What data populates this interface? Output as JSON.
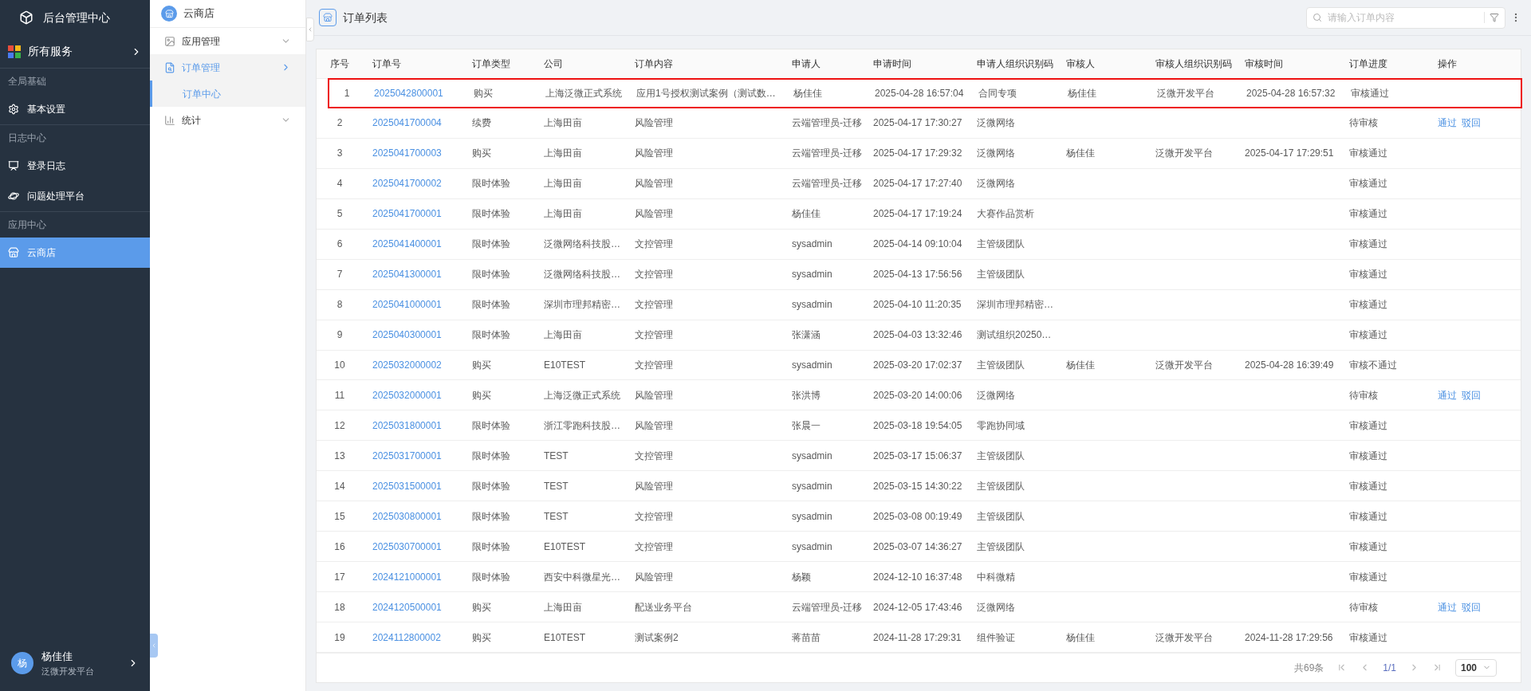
{
  "sidebar": {
    "title": "后台管理中心",
    "services": "所有服务",
    "sections": [
      {
        "label": "全局基础",
        "items": [
          {
            "label": "基本设置",
            "selected": false
          }
        ]
      },
      {
        "label": "日志中心",
        "items": [
          {
            "label": "登录日志",
            "selected": false
          },
          {
            "label": "问题处理平台",
            "selected": false
          }
        ]
      },
      {
        "label": "应用中心",
        "items": [
          {
            "label": "云商店",
            "selected": true
          }
        ]
      }
    ],
    "user": {
      "avatar": "杨",
      "name": "杨佳佳",
      "org": "泛微开发平台"
    }
  },
  "subnav": {
    "title": "云商店",
    "items": [
      {
        "label": "应用管理",
        "selected": false,
        "expanded": false
      },
      {
        "label": "订单管理",
        "selected": true,
        "expanded": true,
        "children": [
          {
            "label": "订单中心",
            "selected": true
          }
        ]
      },
      {
        "label": "统计",
        "selected": false,
        "expanded": false
      }
    ]
  },
  "header": {
    "title": "订单列表",
    "search": {
      "placeholder": "请输入订单内容"
    }
  },
  "table": {
    "columns": [
      "序号",
      "订单号",
      "订单类型",
      "公司",
      "订单内容",
      "申请人",
      "申请时间",
      "申请人组织识别码",
      "审核人",
      "审核人组织识别码",
      "审核时间",
      "订单进度",
      "操作"
    ],
    "rows": [
      {
        "seq": "1",
        "order_no": "2025042800001",
        "type": "购买",
        "company": "上海泛微正式系统",
        "content": "应用1号授权测试案例（测试数…",
        "applicant": "杨佳佳",
        "apply_time": "2025-04-28 16:57:04",
        "applicant_org": "合同专项",
        "reviewer": "杨佳佳",
        "reviewer_org": "泛微开发平台",
        "review_time": "2025-04-28 16:57:32",
        "progress": "审核通过",
        "highlighted": true
      },
      {
        "seq": "2",
        "order_no": "2025041700004",
        "type": "续费",
        "company": "上海田亩",
        "content": "风险管理",
        "applicant": "云端管理员-迁移",
        "apply_time": "2025-04-17 17:30:27",
        "applicant_org": "泛微网络",
        "progress": "待审核",
        "actions": [
          "通过",
          "驳回"
        ],
        "highlighted": false
      },
      {
        "seq": "3",
        "order_no": "2025041700003",
        "type": "购买",
        "company": "上海田亩",
        "content": "风险管理",
        "applicant": "云端管理员-迁移",
        "apply_time": "2025-04-17 17:29:32",
        "applicant_org": "泛微网络",
        "reviewer": "杨佳佳",
        "reviewer_org": "泛微开发平台",
        "review_time": "2025-04-17 17:29:51",
        "progress": "审核通过",
        "highlighted": false
      },
      {
        "seq": "4",
        "order_no": "2025041700002",
        "type": "限时体验",
        "company": "上海田亩",
        "content": "风险管理",
        "applicant": "云端管理员-迁移",
        "apply_time": "2025-04-17 17:27:40",
        "applicant_org": "泛微网络",
        "progress": "审核通过",
        "highlighted": false
      },
      {
        "seq": "5",
        "order_no": "2025041700001",
        "type": "限时体验",
        "company": "上海田亩",
        "content": "风险管理",
        "applicant": "杨佳佳",
        "apply_time": "2025-04-17 17:19:24",
        "applicant_org": "大赛作品赏析",
        "progress": "审核通过",
        "highlighted": false
      },
      {
        "seq": "6",
        "order_no": "2025041400001",
        "type": "限时体验",
        "company": "泛微网络科技股…",
        "content": "文控管理",
        "applicant": "sysadmin",
        "apply_time": "2025-04-14 09:10:04",
        "applicant_org": "主管级团队",
        "progress": "审核通过",
        "highlighted": false
      },
      {
        "seq": "7",
        "order_no": "2025041300001",
        "type": "限时体验",
        "company": "泛微网络科技股…",
        "content": "文控管理",
        "applicant": "sysadmin",
        "apply_time": "2025-04-13 17:56:56",
        "applicant_org": "主管级团队",
        "progress": "审核通过",
        "highlighted": false
      },
      {
        "seq": "8",
        "order_no": "2025041000001",
        "type": "限时体验",
        "company": "深圳市理邦精密…",
        "content": "文控管理",
        "applicant": "sysadmin",
        "apply_time": "2025-04-10 11:20:35",
        "applicant_org": "深圳市理邦精密…",
        "progress": "审核通过",
        "highlighted": false
      },
      {
        "seq": "9",
        "order_no": "2025040300001",
        "type": "限时体验",
        "company": "上海田亩",
        "content": "文控管理",
        "applicant": "张潇涵",
        "apply_time": "2025-04-03 13:32:46",
        "applicant_org": "测试组织20250…",
        "progress": "审核通过",
        "highlighted": false
      },
      {
        "seq": "10",
        "order_no": "2025032000002",
        "type": "购买",
        "company": "E10TEST",
        "content": "文控管理",
        "applicant": "sysadmin",
        "apply_time": "2025-03-20 17:02:37",
        "applicant_org": "主管级团队",
        "reviewer": "杨佳佳",
        "reviewer_org": "泛微开发平台",
        "review_time": "2025-04-28 16:39:49",
        "progress": "审核不通过",
        "highlighted": false
      },
      {
        "seq": "11",
        "order_no": "2025032000001",
        "type": "购买",
        "company": "上海泛微正式系统",
        "content": "风险管理",
        "applicant": "张洪博",
        "apply_time": "2025-03-20 14:00:06",
        "applicant_org": "泛微网络",
        "progress": "待审核",
        "actions": [
          "通过",
          "驳回"
        ],
        "highlighted": false
      },
      {
        "seq": "12",
        "order_no": "2025031800001",
        "type": "限时体验",
        "company": "浙江零跑科技股…",
        "content": "风险管理",
        "applicant": "张晨一",
        "apply_time": "2025-03-18 19:54:05",
        "applicant_org": "零跑协同域",
        "progress": "审核通过",
        "highlighted": false
      },
      {
        "seq": "13",
        "order_no": "2025031700001",
        "type": "限时体验",
        "company": "TEST",
        "content": "文控管理",
        "applicant": "sysadmin",
        "apply_time": "2025-03-17 15:06:37",
        "applicant_org": "主管级团队",
        "progress": "审核通过",
        "highlighted": false
      },
      {
        "seq": "14",
        "order_no": "2025031500001",
        "type": "限时体验",
        "company": "TEST",
        "content": "风险管理",
        "applicant": "sysadmin",
        "apply_time": "2025-03-15 14:30:22",
        "applicant_org": "主管级团队",
        "progress": "审核通过",
        "highlighted": false
      },
      {
        "seq": "15",
        "order_no": "2025030800001",
        "type": "限时体验",
        "company": "TEST",
        "content": "文控管理",
        "applicant": "sysadmin",
        "apply_time": "2025-03-08 00:19:49",
        "applicant_org": "主管级团队",
        "progress": "审核通过",
        "highlighted": false
      },
      {
        "seq": "16",
        "order_no": "2025030700001",
        "type": "限时体验",
        "company": "E10TEST",
        "content": "文控管理",
        "applicant": "sysadmin",
        "apply_time": "2025-03-07 14:36:27",
        "applicant_org": "主管级团队",
        "progress": "审核通过",
        "highlighted": false
      },
      {
        "seq": "17",
        "order_no": "2024121000001",
        "type": "限时体验",
        "company": "西安中科微星光…",
        "content": "风险管理",
        "applicant": "杨颖",
        "apply_time": "2024-12-10 16:37:48",
        "applicant_org": "中科微精",
        "progress": "审核通过",
        "highlighted": false
      },
      {
        "seq": "18",
        "order_no": "2024120500001",
        "type": "购买",
        "company": "上海田亩",
        "content": "配送业务平台",
        "applicant": "云端管理员-迁移",
        "apply_time": "2024-12-05 17:43:46",
        "applicant_org": "泛微网络",
        "progress": "待审核",
        "actions": [
          "通过",
          "驳回"
        ],
        "highlighted": false
      },
      {
        "seq": "19",
        "order_no": "2024112800002",
        "type": "购买",
        "company": "E10TEST",
        "content": "测试案例2",
        "applicant": "蒋苗苗",
        "apply_time": "2024-11-28 17:29:31",
        "applicant_org": "组件验证",
        "reviewer": "杨佳佳",
        "reviewer_org": "泛微开发平台",
        "review_time": "2024-11-28 17:29:56",
        "progress": "审核通过",
        "highlighted": false
      }
    ]
  },
  "pagination": {
    "total": "共69条",
    "page": "1/1",
    "page_size": "100"
  }
}
